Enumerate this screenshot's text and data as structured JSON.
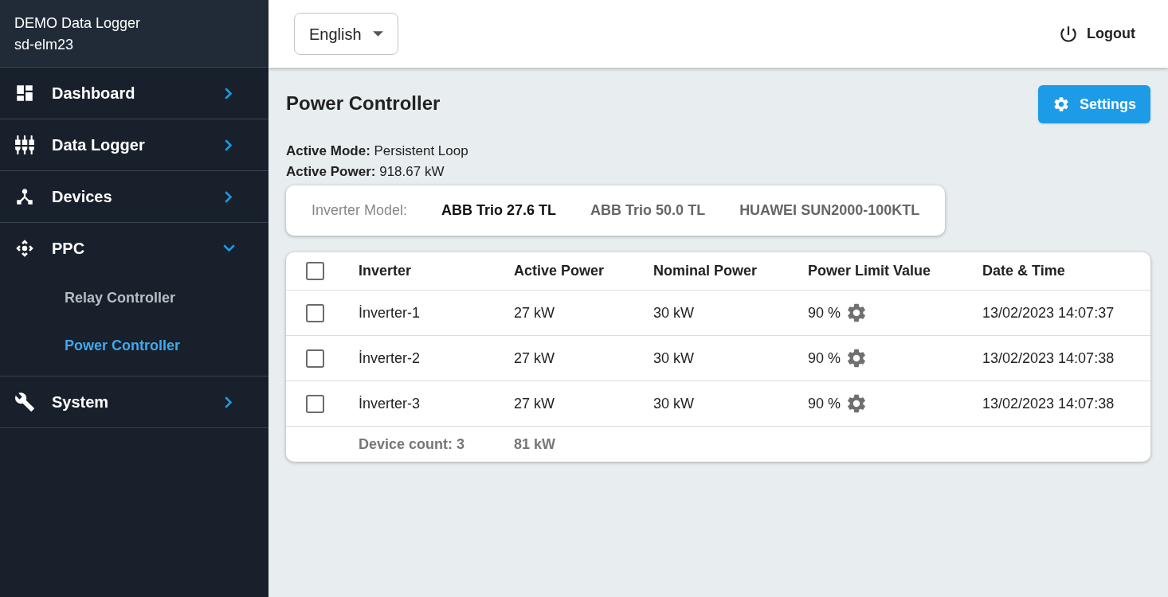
{
  "sidebar": {
    "title": "DEMO Data Logger",
    "subtitle": "sd-elm23",
    "items": [
      {
        "label": "Dashboard",
        "expanded": false
      },
      {
        "label": "Data Logger",
        "expanded": false
      },
      {
        "label": "Devices",
        "expanded": false
      },
      {
        "label": "PPC",
        "expanded": true,
        "children": [
          {
            "label": "Relay Controller",
            "selected": false
          },
          {
            "label": "Power Controller",
            "selected": true
          }
        ]
      },
      {
        "label": "System",
        "expanded": false
      }
    ]
  },
  "topbar": {
    "language": "English",
    "logout": "Logout"
  },
  "page": {
    "title": "Power Controller",
    "settings_button": "Settings",
    "info": [
      {
        "label": "Active Mode:",
        "value": "Persistent Loop"
      },
      {
        "label": "Active Power:",
        "value": "918.67 kW"
      }
    ],
    "model_tabs": {
      "label": "Inverter Model:",
      "tabs": [
        {
          "label": "ABB Trio 27.6 TL",
          "selected": true
        },
        {
          "label": "ABB Trio 50.0 TL",
          "selected": false
        },
        {
          "label": "HUAWEI SUN2000-100KTL",
          "selected": false
        }
      ]
    },
    "table": {
      "columns": [
        "Inverter",
        "Active Power",
        "Nominal Power",
        "Power Limit Value",
        "Date & Time"
      ],
      "all_checked": false,
      "rows": [
        {
          "checked": false,
          "cells": [
            "İnverter-1",
            "27 kW",
            "30 kW",
            "90 %",
            "13/02/2023 14:07:37"
          ]
        },
        {
          "checked": false,
          "cells": [
            "İnverter-2",
            "27 kW",
            "30 kW",
            "90 %",
            "13/02/2023 14:07:38"
          ]
        },
        {
          "checked": false,
          "cells": [
            "İnverter-3",
            "27 kW",
            "30 kW",
            "90 %",
            "13/02/2023 14:07:38"
          ]
        }
      ],
      "footer": [
        "Device count: 3",
        "81 kW"
      ]
    }
  }
}
